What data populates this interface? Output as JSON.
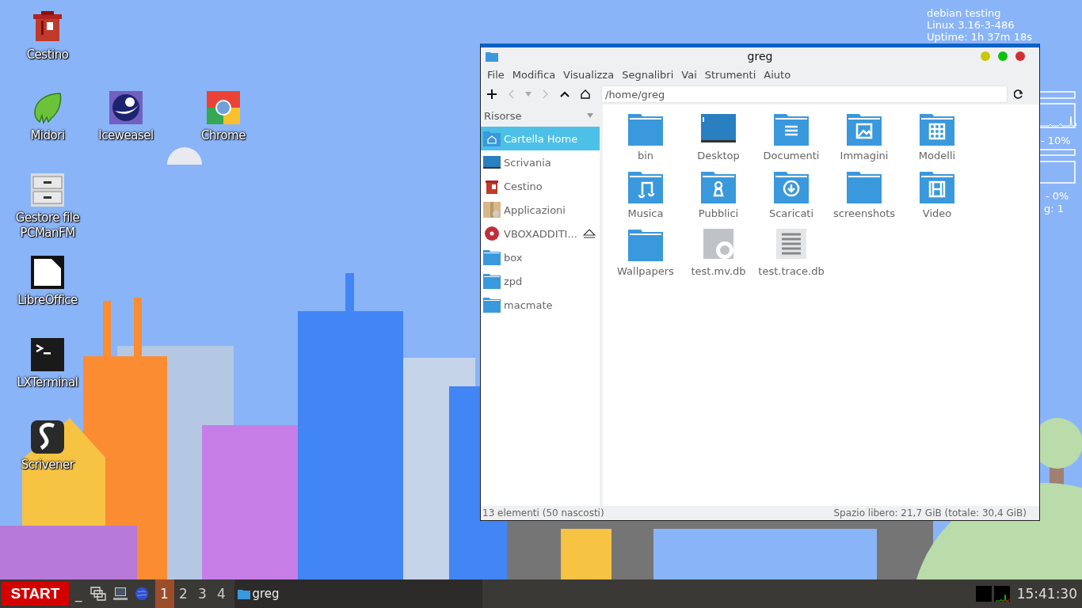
{
  "desktop_icons": [
    {
      "label": "Cestino",
      "kind": "trash"
    },
    {
      "label": "Midori",
      "kind": "leaf"
    },
    {
      "label": "Iceweasel",
      "kind": "weasel"
    },
    {
      "label": "Chrome",
      "kind": "chrome"
    },
    {
      "label": "Gestore file PCManFM",
      "kind": "cabinet"
    },
    {
      "label": "LibreOffice",
      "kind": "document"
    },
    {
      "label": "LXTerminal",
      "kind": "terminal"
    },
    {
      "label": "Scrivener",
      "kind": "scroll"
    }
  ],
  "conky": {
    "lines": [
      "debian testing",
      "Linux 3.16-3-486",
      "Uptime: 1h 37m 18s"
    ],
    "cpu_reading": "- 10%",
    "swap_reading": "- 0%",
    "process_reading": "g: 1"
  },
  "window": {
    "title": "greg",
    "menu": [
      "File",
      "Modifica",
      "Visualizza",
      "Segnalibri",
      "Vai",
      "Strumenti",
      "Aiuto"
    ],
    "path": "/home/greg",
    "sidebar": {
      "header": "Risorse",
      "items": [
        {
          "label": "Cartella Home",
          "kind": "home",
          "selected": true,
          "ejectable": false
        },
        {
          "label": "Scrivania",
          "kind": "desktop",
          "selected": false,
          "ejectable": false
        },
        {
          "label": "Cestino",
          "kind": "trash",
          "selected": false,
          "ejectable": false
        },
        {
          "label": "Applicazioni",
          "kind": "package",
          "selected": false,
          "ejectable": false
        },
        {
          "label": "VBOXADDITI...",
          "kind": "disc",
          "selected": false,
          "ejectable": true
        },
        {
          "label": "box",
          "kind": "folder",
          "selected": false,
          "ejectable": false
        },
        {
          "label": "zpd",
          "kind": "folder",
          "selected": false,
          "ejectable": false
        },
        {
          "label": "macmate",
          "kind": "folder",
          "selected": false,
          "ejectable": false
        }
      ]
    },
    "files": [
      {
        "name": "bin",
        "kind": "folder"
      },
      {
        "name": "Desktop",
        "kind": "desktop"
      },
      {
        "name": "Documenti",
        "kind": "documents"
      },
      {
        "name": "Immagini",
        "kind": "pictures"
      },
      {
        "name": "Modelli",
        "kind": "templates"
      },
      {
        "name": "Musica",
        "kind": "music"
      },
      {
        "name": "Pubblici",
        "kind": "public"
      },
      {
        "name": "Scaricati",
        "kind": "downloads"
      },
      {
        "name": "screenshots",
        "kind": "folder"
      },
      {
        "name": "Video",
        "kind": "video"
      },
      {
        "name": "Wallpapers",
        "kind": "folder"
      },
      {
        "name": "test.mv.db",
        "kind": "database"
      },
      {
        "name": "test.trace.db",
        "kind": "text"
      }
    ],
    "status_left": "13 elementi (50 nascosti)",
    "status_right": "Spazio libero: 21,7 GiB (totale: 30,4 GiB)"
  },
  "taskbar": {
    "start": "START",
    "show_desktop": "_",
    "workspaces": [
      {
        "label": "1",
        "selected": true
      },
      {
        "label": "2",
        "selected": false
      },
      {
        "label": "3",
        "selected": false
      },
      {
        "label": "4",
        "selected": false
      }
    ],
    "tasks": [
      {
        "label": "greg",
        "selected": false
      }
    ],
    "clock": "15:41:30"
  }
}
